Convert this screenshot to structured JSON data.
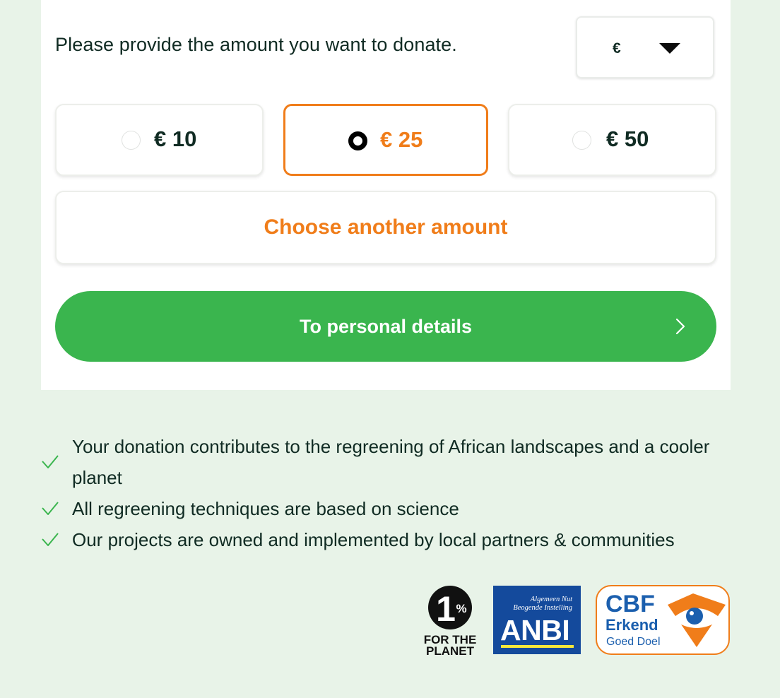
{
  "form": {
    "prompt": "Please provide the amount you want to donate.",
    "currency": {
      "value": "€"
    },
    "amounts": [
      {
        "label": "€ 10",
        "selected": false
      },
      {
        "label": "€ 25",
        "selected": true
      },
      {
        "label": "€ 50",
        "selected": false
      }
    ],
    "other_amount_label": "Choose another amount",
    "submit_label": "To personal details"
  },
  "usps": [
    "Your donation contributes to the regreening of African landscapes and a cooler planet",
    "All regreening techniques are based on science",
    "Our projects are owned and implemented by local partners & communities"
  ],
  "logos": {
    "one_percent": {
      "numeral": "1",
      "symbol": "%",
      "line1": "FOR THE",
      "line2": "PLANET"
    },
    "anbi": {
      "line1": "Algemeen Nut",
      "line2": "Beogende Instelling",
      "name": "ANBI"
    },
    "cbf": {
      "name": "CBF",
      "line2": "Erkend",
      "line3": "Goed Doel"
    }
  },
  "colors": {
    "background": "#e8f3e8",
    "accent_orange": "#f07d1a",
    "cta_green": "#3ab54e",
    "check_green": "#3ab54e",
    "text_dark": "#102b23",
    "anbi_blue": "#144a9c",
    "cbf_blue": "#1b5fae"
  },
  "icons": {
    "currency_dropdown": "caret-down-icon",
    "submit": "chevron-right-icon",
    "usp": "checkmark-icon"
  }
}
